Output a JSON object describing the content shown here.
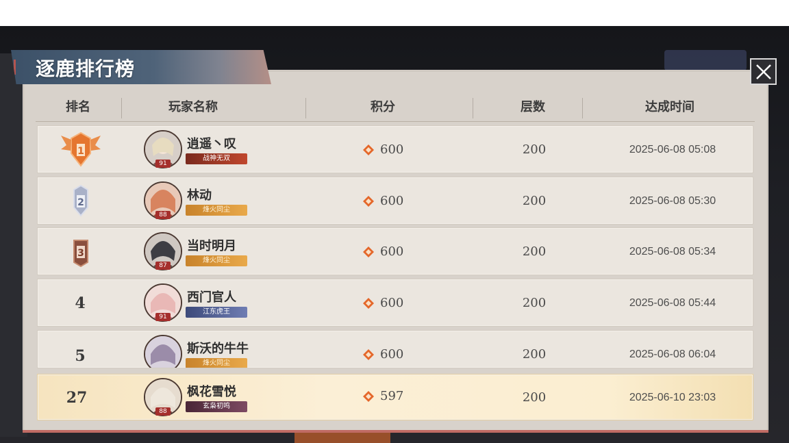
{
  "window": {
    "title": "逐鹿排行榜",
    "close_icon": "close-icon"
  },
  "table": {
    "headers": [
      "排名",
      "玩家名称",
      "积分",
      "层数",
      "达成时间"
    ],
    "rows": [
      {
        "rank": "1",
        "rank_badge": "gold-rank-badge-icon",
        "name": "逍遥丶叹",
        "level": "91",
        "title": "战神无双",
        "score": "600",
        "floors": "200",
        "time": "2025-06-08 05:08"
      },
      {
        "rank": "2",
        "rank_badge": "silver-rank-badge-icon",
        "name": "林动",
        "level": "88",
        "title": "烽火同尘",
        "score": "600",
        "floors": "200",
        "time": "2025-06-08 05:30"
      },
      {
        "rank": "3",
        "rank_badge": "bronze-rank-badge-icon",
        "name": "当时明月",
        "level": "87",
        "title": "烽火同尘",
        "score": "600",
        "floors": "200",
        "time": "2025-06-08 05:34"
      },
      {
        "rank": "4",
        "name": "西门官人",
        "level": "91",
        "title": "江东虎王",
        "score": "600",
        "floors": "200",
        "time": "2025-06-08 05:44"
      },
      {
        "rank": "5",
        "name": "斯沃的牛牛",
        "level": "",
        "title": "烽火同尘",
        "score": "600",
        "floors": "200",
        "time": "2025-06-08 06:04"
      }
    ],
    "my_row": {
      "rank": "27",
      "name": "枫花雪悦",
      "level": "88",
      "title": "玄枭初鸣",
      "score": "597",
      "floors": "200",
      "time": "2025-06-10 23:03"
    }
  },
  "colors": {
    "accent": "#e4672a",
    "my_row_bg": "#fbefd6",
    "panel_bg": "#d8d2cb"
  }
}
